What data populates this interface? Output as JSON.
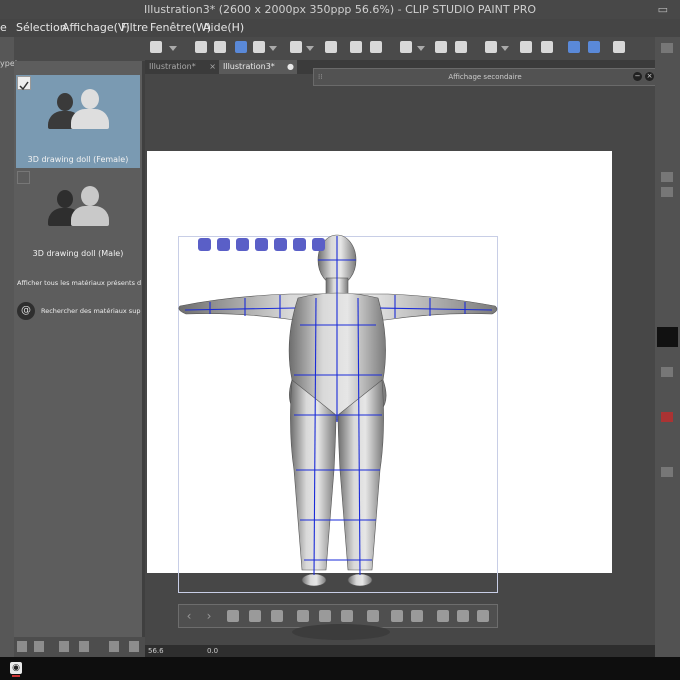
{
  "window": {
    "title": "Illustration3* (2600 x 2000px 350ppp 56.6%) - CLIP STUDIO PAINT PRO"
  },
  "menu": [
    "e",
    "Sélection",
    "Affichage(V)",
    "Filtre",
    "Fenêtre(W)",
    "Aide(H)"
  ],
  "left_strip": {
    "label": "ype)"
  },
  "materials": {
    "items": [
      {
        "label": "3D drawing doll (Female)",
        "selected": true
      },
      {
        "label": "3D drawing doll (Male)",
        "selected": false
      }
    ],
    "show_all_text": "Afficher tous les matériaux présents dans le d",
    "search_text": "Rechercher des matériaux supplém"
  },
  "tabs": [
    {
      "label": "Illustration*",
      "close": "×"
    },
    {
      "label": "Illustration3*",
      "close": "●"
    }
  ],
  "secondary_view": {
    "title": "Affichage secondaire",
    "min_icon": "−",
    "close_icon": "×"
  },
  "status": {
    "zoom": "56.6",
    "angle": "0.0"
  },
  "colors": {
    "mesh_lines": "#1a2bd8",
    "selected_card": "#7a9ab2",
    "background": "#4a4a4a"
  }
}
